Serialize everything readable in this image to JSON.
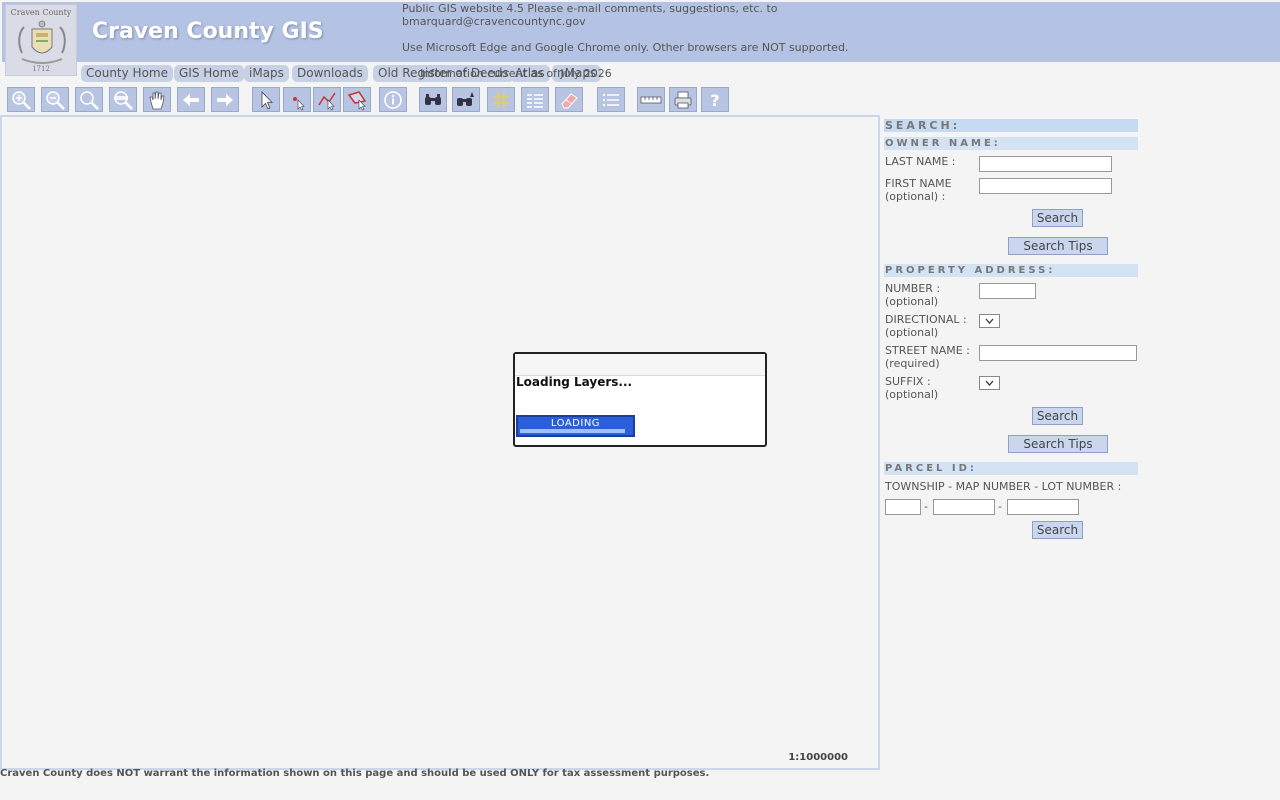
{
  "header": {
    "logo_top_text": "Craven County",
    "logo_year": "1712",
    "site_title": "Craven County GIS",
    "notice_line_1": "Public GIS website 4.5 Please e-mail comments, suggestions, etc. to bmarquard@cravencountync.gov",
    "notice_line_2": "Use Microsoft Edge and Google Chrome only. Other browsers are NOT supported."
  },
  "nav": {
    "links": [
      "County Home",
      "GIS Home",
      "iMaps",
      "Downloads",
      "Old Register of Deeds",
      "Atlas",
      "nMaps"
    ],
    "updated_text": "Information current as of July 2026"
  },
  "toolbar": {
    "tools": [
      "zoom-in-icon",
      "zoom-out-icon",
      "full-extent-icon",
      "zoom-selected-icon",
      "pan-icon",
      "previous-extent-icon",
      "next-extent-icon",
      "select-icon",
      "select-point-icon",
      "select-line-icon",
      "select-polygon-icon",
      "identify-icon",
      "find-icon",
      "advanced-find-icon",
      "buffer-icon",
      "results-table-icon",
      "clear-selection-icon",
      "layers-icon",
      "measure-icon",
      "print-icon",
      "help-icon"
    ]
  },
  "map": {
    "scale": "1:1000000",
    "loading": {
      "message": "Loading Layers...",
      "bar_label": "LOADING",
      "progress": 0.95
    }
  },
  "search": {
    "title": "SEARCH:",
    "owner": {
      "header": "OWNER NAME:",
      "last_name_label": "LAST NAME :",
      "last_name_value": "",
      "first_name_label": "FIRST NAME",
      "first_name_optional": "(optional) :",
      "first_name_value": "",
      "search_button": "Search",
      "tips_button": "Search Tips"
    },
    "address": {
      "header": "PROPERTY ADDRESS:",
      "number_label": "NUMBER :",
      "number_optional": "(optional)",
      "number_value": "",
      "directional_label": "DIRECTIONAL :",
      "directional_optional": "(optional)",
      "directional_value": "",
      "street_label": "STREET NAME :",
      "street_required": "(required)",
      "street_value": "",
      "suffix_label": "SUFFIX :",
      "suffix_optional": "(optional)",
      "suffix_value": "",
      "search_button": "Search",
      "tips_button": "Search Tips"
    },
    "parcel": {
      "header": "PARCEL ID:",
      "fields_label": "TOWNSHIP - MAP NUMBER - LOT NUMBER :",
      "separator": "-",
      "township_value": "",
      "map_number_value": "",
      "lot_number_value": "",
      "search_button": "Search"
    }
  },
  "footer": {
    "disclaimer": "Craven County does NOT warrant the information shown on this page and should be used ONLY for tax assessment purposes."
  },
  "colors": {
    "header_bg": "#b4c3e3",
    "tool_bg": "#b7c4e2",
    "section_header_bg": "#d4e3f4",
    "loading_bar": "#2a5fd9"
  }
}
